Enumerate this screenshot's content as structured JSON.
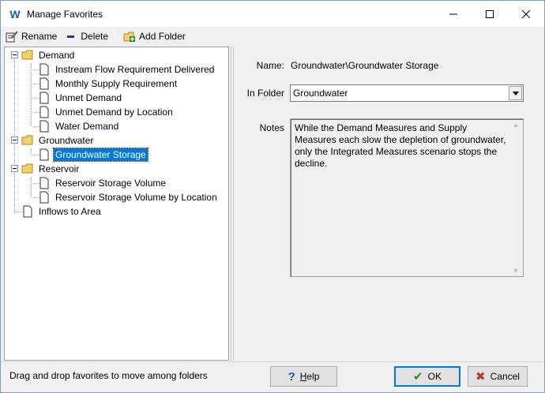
{
  "window": {
    "title": "Manage Favorites",
    "app_icon_letter": "W"
  },
  "toolbar": {
    "rename_label": "Rename",
    "delete_label": "Delete",
    "add_folder_label": "Add Folder"
  },
  "tree": {
    "folders": [
      {
        "label": "Demand",
        "items": [
          "Instream Flow Requirement Delivered",
          "Monthly Supply Requirement",
          "Unmet Demand",
          "Unmet Demand by Location",
          "Water Demand"
        ]
      },
      {
        "label": "Groundwater",
        "items": [
          "Groundwater Storage"
        ]
      },
      {
        "label": "Reservoir",
        "items": [
          "Reservoir Storage Volume",
          "Reservoir Storage Volume by Location"
        ]
      }
    ],
    "root_items": [
      "Inflows to Area"
    ],
    "selected": "Groundwater Storage"
  },
  "details": {
    "name_label": "Name:",
    "name_value": "Groundwater\\Groundwater Storage",
    "folder_label": "In Folder",
    "folder_value": "Groundwater",
    "notes_label": "Notes",
    "notes_value": "While the Demand Measures and Supply Measures each slow the depletion of groundwater, only the Integrated Measures scenario stops the decline."
  },
  "footer": {
    "hint": "Drag and drop favorites to move among folders",
    "help_label_underlined": "H",
    "help_label_rest": "elp",
    "ok_label": "OK",
    "cancel_label": "Cancel"
  },
  "colors": {
    "selection": "#0078d7",
    "folder": "#f4d06f",
    "ok_check": "#2a8a2a",
    "cancel_x": "#c0392b",
    "help_mark": "#1e5bb8"
  }
}
